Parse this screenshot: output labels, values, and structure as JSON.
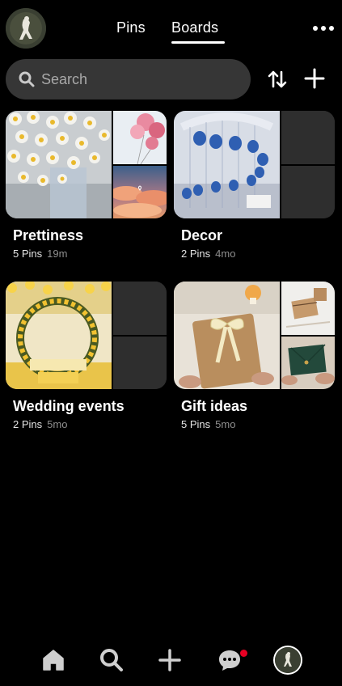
{
  "header": {
    "tabs": [
      {
        "label": "Pins",
        "active": false
      },
      {
        "label": "Boards",
        "active": true
      }
    ],
    "more_icon": "ellipsis-icon",
    "profile_icon": "avatar"
  },
  "search": {
    "placeholder": "Search",
    "value": "",
    "icon": "search-icon"
  },
  "actions": {
    "sort_icon": "sort-arrows-icon",
    "add_icon": "plus-icon"
  },
  "boards": [
    {
      "title": "Prettiness",
      "pins": "5 Pins",
      "updated": "19m"
    },
    {
      "title": "Decor",
      "pins": "2 Pins",
      "updated": "4mo"
    },
    {
      "title": "Wedding events",
      "pins": "2 Pins",
      "updated": "5mo"
    },
    {
      "title": "Gift ideas",
      "pins": "5 Pins",
      "updated": "5mo"
    }
  ],
  "bottom_nav": {
    "items": [
      "home-icon",
      "search-icon",
      "plus-icon",
      "chat-bubble-icon",
      "avatar"
    ],
    "notification_color": "#e60023"
  },
  "colors": {
    "background": "#000000",
    "search_bg": "#363636",
    "accent": "#e60023"
  }
}
